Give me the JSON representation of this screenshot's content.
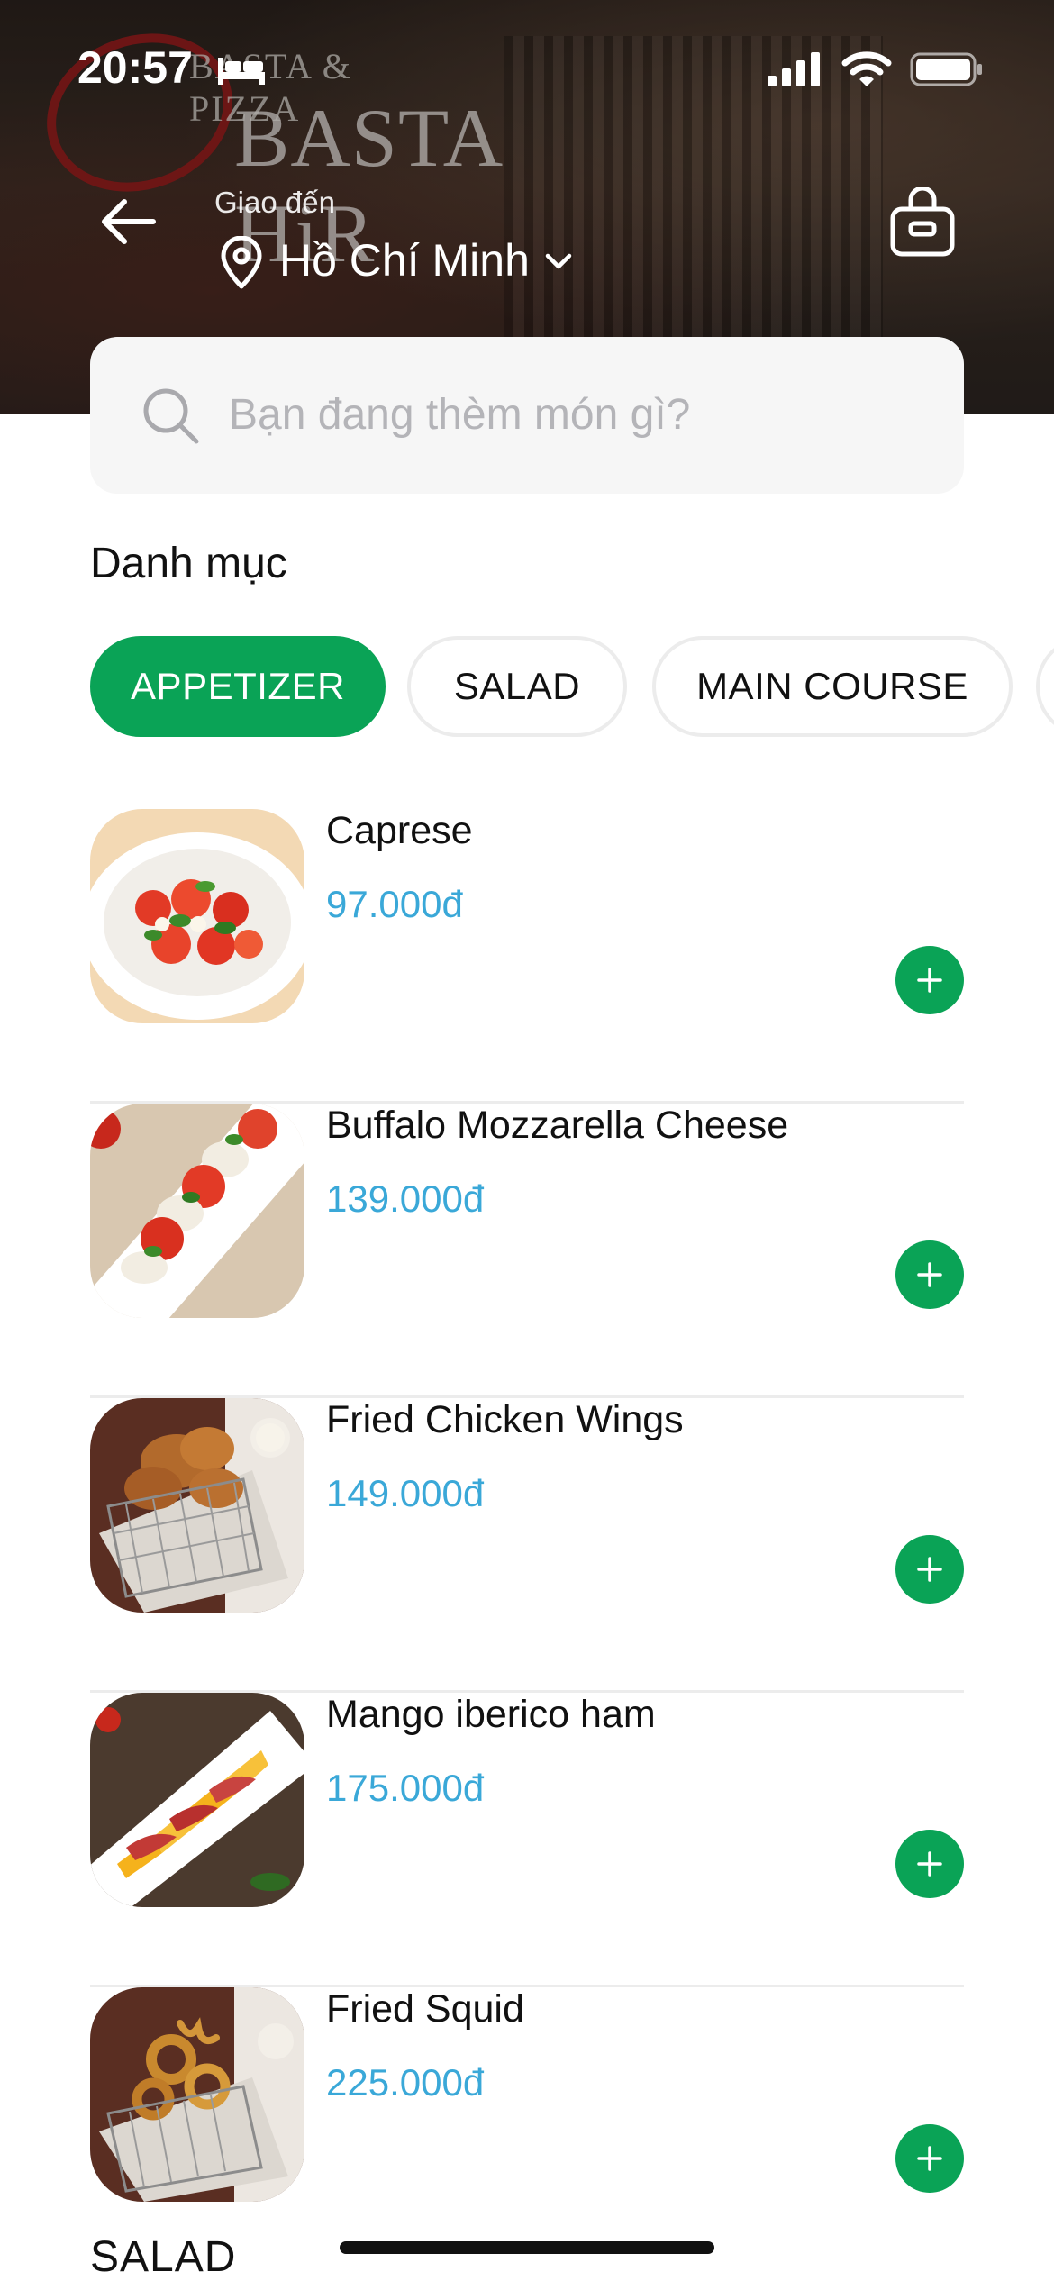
{
  "status_bar": {
    "time": "20:57"
  },
  "banner": {
    "brand_sub": "BASTA & PIZZA",
    "brand_main": "BASTA HiR"
  },
  "header": {
    "deliver_label": "Giao đến",
    "city": "Hồ Chí Minh"
  },
  "search": {
    "placeholder": "Bạn đang thèm món gì?"
  },
  "category": {
    "title": "Danh mục",
    "chips": [
      {
        "label": "APPETIZER",
        "active": true
      },
      {
        "label": "SALAD",
        "active": false
      },
      {
        "label": "MAIN COURSE",
        "active": false
      }
    ]
  },
  "menu": {
    "items": [
      {
        "name": "Caprese",
        "price": "97.000đ",
        "image": "caprese-photo"
      },
      {
        "name": "Buffalo Mozzarella Cheese",
        "price": "139.000đ",
        "image": "mozzarella-photo"
      },
      {
        "name": "Fried Chicken Wings",
        "price": "149.000đ",
        "image": "chicken-wings-photo"
      },
      {
        "name": "Mango iberico ham",
        "price": "175.000đ",
        "image": "mango-ham-photo"
      },
      {
        "name": "Fried Squid",
        "price": "225.000đ",
        "image": "fried-squid-photo"
      }
    ],
    "next_section": "SALAD"
  },
  "colors": {
    "accent_green": "#0aa356",
    "price_blue": "#3aa8d8"
  }
}
